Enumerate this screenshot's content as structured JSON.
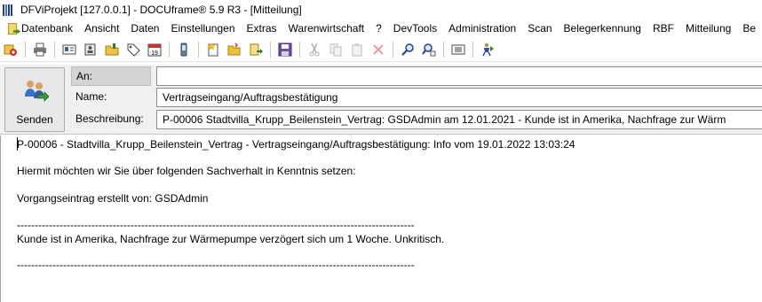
{
  "window": {
    "title": "DFViProjekt [127.0.0.1] - DOCUframe® 5.9 R3 - [Mitteilung]"
  },
  "menubar": {
    "items": [
      "Datenbank",
      "Ansicht",
      "Daten",
      "Einstellungen",
      "Extras",
      "Warenwirtschaft",
      "?",
      "DevTools",
      "Administration",
      "Scan",
      "Belegerkennung",
      "RBF",
      "Mitteilung",
      "Be"
    ]
  },
  "toolbar": {
    "icons": [
      "database-icon",
      "print-icon",
      "card-icon",
      "address-book-icon",
      "folder-icon",
      "tag-icon",
      "calendar-icon",
      "phone-icon",
      "new-document-icon",
      "open-folder-icon",
      "export-document-icon",
      "save-icon",
      "cut-icon",
      "copy-icon",
      "paste-icon",
      "delete-icon",
      "search-icon",
      "search-replace-icon",
      "view-icon",
      "run-person-icon"
    ],
    "calendar_day": "19"
  },
  "form": {
    "send_label": "Senden",
    "an_label": "An:",
    "an_value": "",
    "name_label": "Name:",
    "name_value": "Vertragseingang/Auftragsbestätigung",
    "desc_label": "Beschreibung:",
    "desc_value": "P-00006 Stadtvilla_Krupp_Beilenstein_Vertrag: GSDAdmin am 12.01.2021 - Kunde ist in Amerika, Nachfrage zur Wärm"
  },
  "message": {
    "line1": "P-00006 - Stadtvilla_Krupp_Beilenstein_Vertrag - Vertragseingang/Auftragsbestätigung: Info vom 19.01.2022 13:03:24",
    "line2": "Hiermit möchten wir Sie über folgenden Sachverhalt in Kenntnis setzen:",
    "line3": "Vorgangseintrag erstellt von: GSDAdmin",
    "separator": "----------------------------------------------------------------------------------------------------------------",
    "line4": "Kunde ist in Amerika, Nachfrage zur Wärmepumpe verzögert sich um 1 Woche. Unkritisch."
  }
}
